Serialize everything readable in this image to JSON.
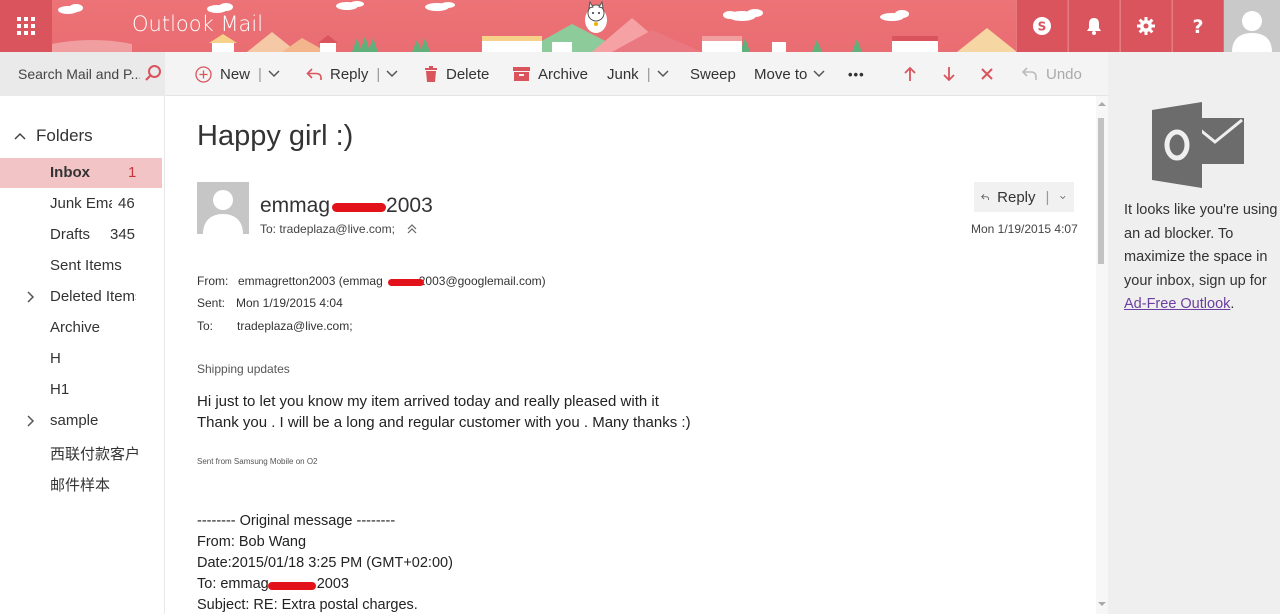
{
  "header": {
    "app_title": "Outlook Mail",
    "icons": [
      "app-launcher-icon",
      "skype-icon",
      "bell-icon",
      "gear-icon",
      "help-icon",
      "user-avatar-icon"
    ],
    "accent_color": "#e6696e",
    "dark_accent_color": "#d9545c"
  },
  "toolbar": {
    "search_placeholder": "Search Mail and P...",
    "new_label": "New",
    "reply_label": "Reply",
    "delete_label": "Delete",
    "archive_label": "Archive",
    "junk_label": "Junk",
    "sweep_label": "Sweep",
    "moveto_label": "Move to",
    "more_label": "•••",
    "undo_label": "Undo",
    "separator": "|"
  },
  "folders": {
    "heading": "Folders",
    "items": [
      {
        "name": "Inbox",
        "count": "1"
      },
      {
        "name": "Junk Ema",
        "count": "46"
      },
      {
        "name": "Drafts",
        "count": "345"
      },
      {
        "name": "Sent Items",
        "count": ""
      },
      {
        "name": "Deleted Items",
        "count": ""
      },
      {
        "name": "Archive",
        "count": ""
      },
      {
        "name": "H",
        "count": ""
      },
      {
        "name": "H1",
        "count": ""
      },
      {
        "name": "sample",
        "count": ""
      },
      {
        "name": "西联付款客户",
        "count": ""
      },
      {
        "name": "邮件样本",
        "count": ""
      }
    ]
  },
  "message": {
    "subject": "Happy girl :)",
    "sender_name_prefix": "emmag",
    "sender_name_suffix": "2003",
    "to_line": "To:  tradeplaza@live.com;",
    "reply_label": "Reply",
    "date": "Mon 1/19/2015 4:07",
    "from_label": "From:",
    "from_value_prefix": "emmagretton2003 (emmag",
    "from_value_suffix": "2003@googlemail.com)",
    "sent_label": "Sent:",
    "sent_value": "Mon 1/19/2015 4:04",
    "to_label": "To:",
    "to_value": "tradeplaza@live.com;",
    "section_title": "Shipping updates",
    "body_line1": "Hi just to let you know my item arrived today and really pleased with it",
    "body_line2": "Thank you . I will be a long and regular customer with you . Many thanks :)",
    "signature": "Sent from Samsung Mobile on O2",
    "original_header": "-------- Original message --------",
    "orig_from": "From: Bob Wang",
    "orig_date": "Date:2015/01/18 3:25 PM (GMT+02:00)",
    "orig_to_prefix": "To: emmag",
    "orig_to_suffix": "2003",
    "orig_subject": "Subject: RE: Extra postal charges."
  },
  "ad": {
    "text": "It looks like you're using an ad blocker. To maximize the space in your inbox, sign up for ",
    "link_text": "Ad-Free Outlook",
    "suffix": "."
  }
}
